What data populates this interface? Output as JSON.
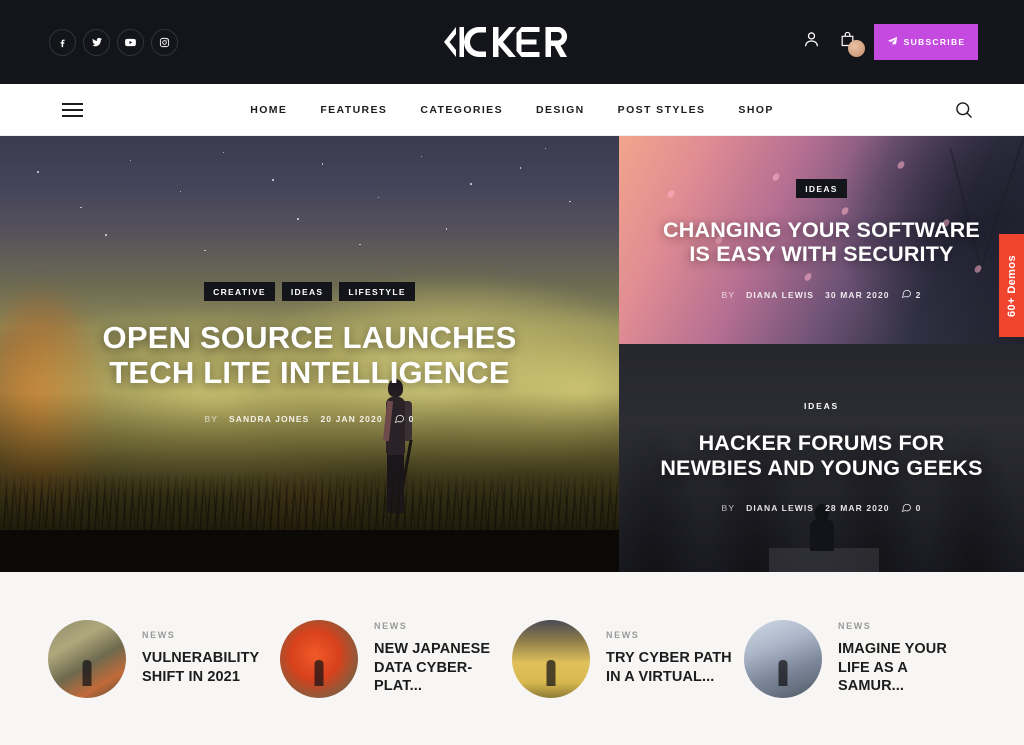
{
  "topbar": {
    "social": [
      {
        "name": "facebook-icon",
        "label": "Facebook"
      },
      {
        "name": "twitter-icon",
        "label": "Twitter"
      },
      {
        "name": "youtube-icon",
        "label": "YouTube"
      },
      {
        "name": "instagram-icon",
        "label": "Instagram"
      }
    ],
    "logo": "KICKER",
    "account_icon": "user-icon",
    "cart_icon": "shopping-bag-icon",
    "subscribe_label": "SUBSCRIBE",
    "subscribe_icon": "paper-plane-icon",
    "accent_color": "#c54ae0",
    "background_color": "#14151a"
  },
  "nav": {
    "menu_icon": "hamburger-icon",
    "search_icon": "search-icon",
    "links": [
      {
        "label": "HOME"
      },
      {
        "label": "FEATURES"
      },
      {
        "label": "CATEGORIES"
      },
      {
        "label": "DESIGN"
      },
      {
        "label": "POST STYLES"
      },
      {
        "label": "SHOP"
      }
    ]
  },
  "demos_tab": {
    "label": "60+ Demos",
    "color": "#f1442e"
  },
  "hero": {
    "featured": {
      "tags": [
        "CREATIVE",
        "IDEAS",
        "LIFESTYLE"
      ],
      "title": "OPEN SOURCE LAUNCHES TECH LITE INTELLIGENCE",
      "by_label": "BY",
      "author": "SANDRA JONES",
      "date": "20 JAN 2020",
      "comments": "0"
    },
    "secondary": [
      {
        "tag": "IDEAS",
        "title": "CHANGING YOUR SOFTWARE IS EASY WITH SECURITY",
        "by_label": "BY",
        "author": "DIANA LEWIS",
        "date": "30 MAR 2020",
        "comments": "2"
      },
      {
        "tag": "IDEAS",
        "title": "HACKER FORUMS FOR NEWBIES AND YOUNG GEEKS",
        "by_label": "BY",
        "author": "DIANA LEWIS",
        "date": "28 MAR 2020",
        "comments": "0"
      }
    ]
  },
  "latest_posts": [
    {
      "category": "NEWS",
      "title": "VULNERABILITY SHIFT IN 2021"
    },
    {
      "category": "NEWS",
      "title": "NEW JAPANESE DATA CYBER-PLAT..."
    },
    {
      "category": "NEWS",
      "title": "TRY CYBER PATH IN A VIRTUAL..."
    },
    {
      "category": "NEWS",
      "title": "IMAGINE YOUR LIFE AS A SAMUR..."
    }
  ]
}
